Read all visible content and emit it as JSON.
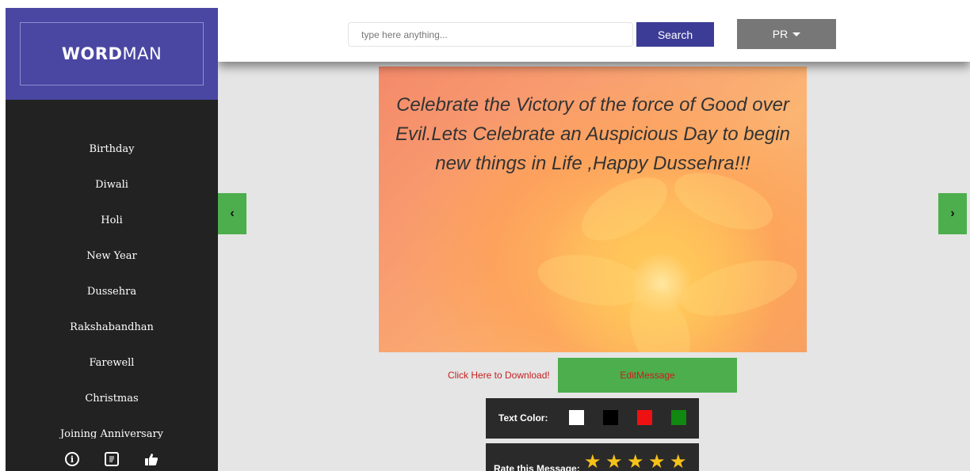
{
  "sidebar": {
    "logo": {
      "bold": "WORD",
      "light": "MAN"
    },
    "items": [
      {
        "label": "Birthday"
      },
      {
        "label": "Diwali"
      },
      {
        "label": "Holi"
      },
      {
        "label": "New Year"
      },
      {
        "label": "Dussehra"
      },
      {
        "label": "Rakshabandhan"
      },
      {
        "label": "Farewell"
      },
      {
        "label": "Christmas"
      },
      {
        "label": "Joining Anniversary"
      }
    ],
    "footer_icons": [
      "info-icon",
      "document-icon",
      "thumbs-up-icon"
    ]
  },
  "topbar": {
    "search_placeholder": "type here anything...",
    "search_label": "Search",
    "lang_label": "PR"
  },
  "card": {
    "message": "Celebrate the Victory of the force of Good over Evil.Lets Celebrate an Auspicious Day to begin new things in Life ,Happy Dussehra!!!"
  },
  "actions": {
    "download_label": "Click Here to Download!",
    "edit_label": "EditMessage"
  },
  "text_color": {
    "label": "Text Color:",
    "swatches": [
      "#ffffff",
      "#000000",
      "#ee1111",
      "#118811"
    ]
  },
  "rating": {
    "label": "Rate this Message:",
    "stars": 5
  },
  "nav": {
    "prev": "‹",
    "next": "›"
  },
  "colors": {
    "accent": "#4a47a3",
    "green": "#4cae4c",
    "sidebar": "#222222"
  }
}
